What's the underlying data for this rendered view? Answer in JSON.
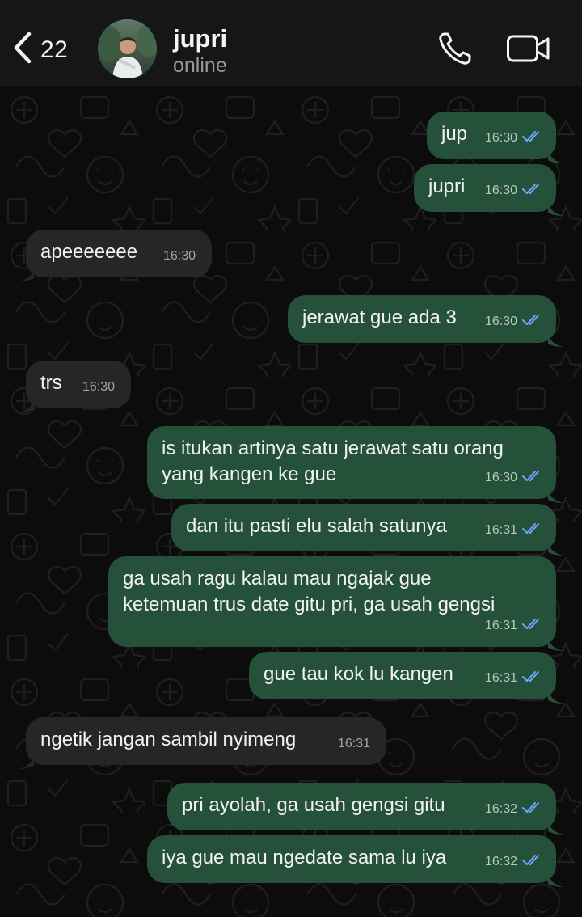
{
  "header": {
    "back_count": "22",
    "contact_name": "jupri",
    "contact_status": "online"
  },
  "icons": {
    "back": "chevron-left-icon",
    "call": "phone-icon",
    "video": "video-camera-icon",
    "read": "double-check-icon"
  },
  "colors": {
    "outgoing_bubble": "#25503a",
    "incoming_bubble": "#262626",
    "read_ticks": "#6fa7ff",
    "header_bg": "#161616"
  },
  "messages": [
    {
      "dir": "out",
      "text": "jup",
      "time": "16:30",
      "read": true
    },
    {
      "dir": "out",
      "text": "jupri",
      "time": "16:30",
      "read": true
    },
    {
      "dir": "in",
      "text": "apeeeeeee",
      "time": "16:30"
    },
    {
      "dir": "out",
      "text": "jerawat gue ada 3",
      "time": "16:30",
      "read": true
    },
    {
      "dir": "in",
      "text": "trs",
      "time": "16:30"
    },
    {
      "dir": "out",
      "text": "is itukan artinya satu jerawat satu orang\nyang kangen ke gue",
      "time": "16:30",
      "read": true
    },
    {
      "dir": "out",
      "text": "dan itu pasti elu salah satunya",
      "time": "16:31",
      "read": true
    },
    {
      "dir": "out",
      "text": "ga usah ragu kalau mau ngajak gue\nketemuan trus date gitu pri, ga usah gengsi",
      "time": "16:31",
      "read": true
    },
    {
      "dir": "out",
      "text": "gue tau kok lu kangen",
      "time": "16:31",
      "read": true
    },
    {
      "dir": "in",
      "text": "ngetik jangan sambil nyimeng",
      "time": "16:31"
    },
    {
      "dir": "out",
      "text": "pri ayolah, ga usah gengsi gitu",
      "time": "16:32",
      "read": true
    },
    {
      "dir": "out",
      "text": "iya gue mau ngedate sama lu iya",
      "time": "16:32",
      "read": true
    }
  ]
}
